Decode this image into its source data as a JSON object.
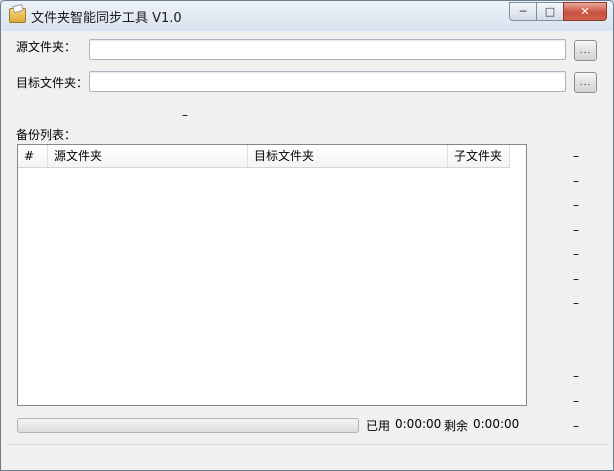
{
  "window": {
    "title": "文件夹智能同步工具 V1.0"
  },
  "caption_buttons": {
    "minimize": "─",
    "maximize": "□",
    "close": "✕"
  },
  "form": {
    "source_label": "源文件夹：",
    "source_value": "",
    "target_label": "目标文件夹：",
    "target_value": "",
    "browse_label": "...",
    "indicator": "–"
  },
  "backup": {
    "label": "备份列表：",
    "columns": [
      "#",
      "源文件夹",
      "目标文件夹",
      "子文件夹"
    ],
    "rows": []
  },
  "side_markers": [
    "–",
    "–",
    "–",
    "–",
    "–",
    "–",
    "–",
    "–",
    "–",
    "–",
    "–",
    "–"
  ],
  "status": {
    "used_label": "已用",
    "used_time": "0:00:00",
    "remaining_label": "剩余",
    "remaining_time": "0:00:00",
    "progress": 0
  }
}
